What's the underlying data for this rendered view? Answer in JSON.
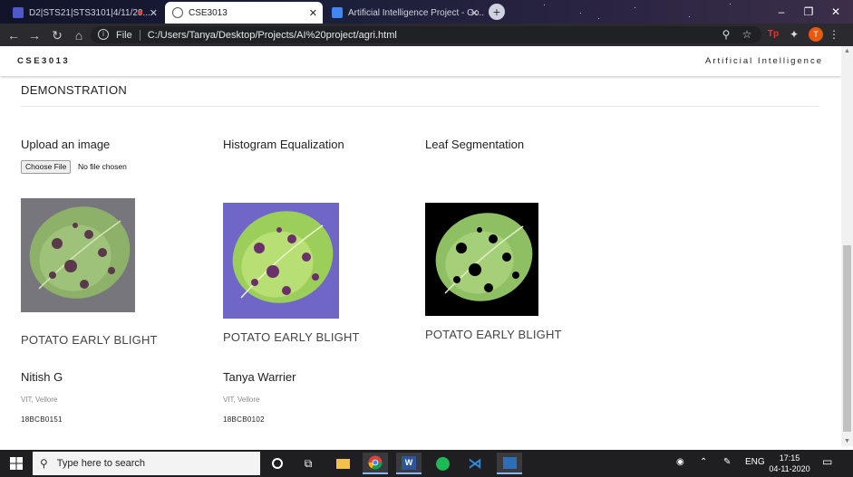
{
  "browser": {
    "tabs": [
      {
        "label": "D2|STS21|STS3101|4/11/20...",
        "icon": "teams-icon"
      },
      {
        "label": "CSE3013",
        "icon": "globe-icon",
        "active": true
      },
      {
        "label": "Artificial Intelligence Project - Go...",
        "icon": "docs-icon"
      }
    ],
    "address": {
      "protocol_label": "File",
      "url": "C:/Users/Tanya/Desktop/Projects/AI%20project/agri.html"
    },
    "profile_initial": "T"
  },
  "page": {
    "navbar": {
      "brand": "CSE3013",
      "right_link": "Artificial Intelligence"
    },
    "section_title": "DEMONSTRATION",
    "columns": {
      "upload": "Upload an image",
      "histogram": "Histogram Equalization",
      "segmentation": "Leaf Segmentation"
    },
    "file_input": {
      "button_label": "Choose File",
      "status": "No file chosen"
    },
    "diagnoses": [
      "POTATO EARLY BLIGHT",
      "POTATO EARLY BLIGHT",
      "POTATO EARLY BLIGHT"
    ],
    "members": [
      {
        "name": "Nitish G",
        "institute": "VIT, Vellore",
        "id": "18BCB0151"
      },
      {
        "name": "Tanya Warrier",
        "institute": "VIT, Vellore",
        "id": "18BCB0102"
      }
    ]
  },
  "taskbar": {
    "search_placeholder": "Type here to search",
    "language": "ENG",
    "time": "17:15",
    "date": "04-11-2020"
  },
  "colors": {
    "leaf_green": "#7fa55a",
    "blight_spot": "#5a3a4a",
    "histogram_bg": "#6f66c8",
    "segmentation_bg": "#000000"
  }
}
